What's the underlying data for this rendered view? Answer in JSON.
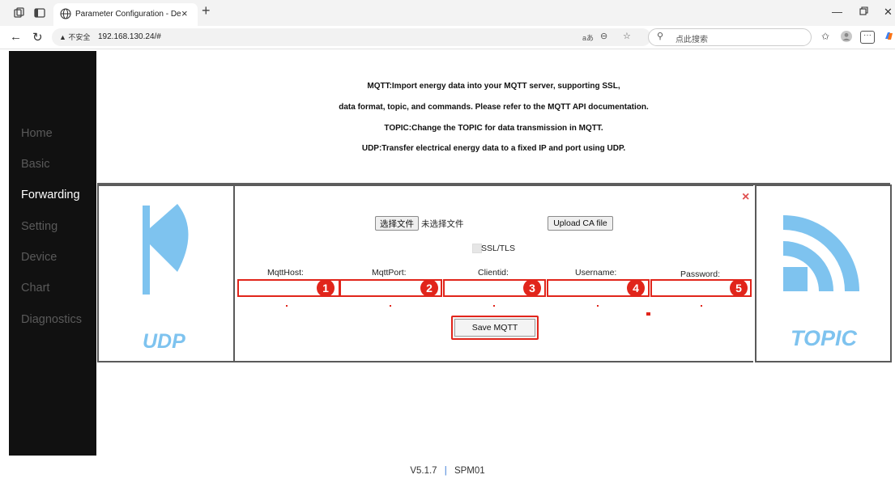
{
  "browser": {
    "tab_title": "Parameter Configuration - Device",
    "tab_close": "×",
    "new_tab": "+",
    "security_label": "不安全",
    "url": "192.168.130.24/#",
    "search_placeholder": "点此搜索",
    "read_aloud": "aあ"
  },
  "sidebar": {
    "items": [
      {
        "label": "Home"
      },
      {
        "label": "Basic"
      },
      {
        "label": "Forwarding"
      },
      {
        "label": "Setting"
      },
      {
        "label": "Device"
      },
      {
        "label": "Chart"
      },
      {
        "label": "Diagnostics"
      }
    ],
    "active": "Forwarding"
  },
  "info": {
    "lines": [
      "MQTT:Import energy data into your MQTT server, supporting SSL,",
      "data format, topic, and commands. Please refer to the MQTT API documentation.",
      "TOPIC:Change the TOPIC for data transmission in MQTT.",
      "UDP:Transfer electrical energy data to a fixed IP and port using UDP."
    ]
  },
  "udp_panel": {
    "label": "UDP"
  },
  "topic_panel": {
    "label": "TOPIC"
  },
  "form": {
    "close": "×",
    "choose_file": "选择文件",
    "no_file": "未选择文件",
    "upload_ca": "Upload CA file",
    "ssl_label": "SSL/TLS",
    "fields": [
      {
        "label": "MqttHost:",
        "value": "",
        "badge": "1"
      },
      {
        "label": "MqttPort:",
        "value": "",
        "badge": "2"
      },
      {
        "label": "Clientid:",
        "value": "",
        "badge": "3"
      },
      {
        "label": "Username:",
        "value": "",
        "badge": "4"
      },
      {
        "label": "Password:",
        "value": "",
        "badge": "5"
      }
    ],
    "save_label": "Save MQTT"
  },
  "footer": {
    "version": "V5.1.7",
    "separator": "|",
    "model": "SPM01"
  },
  "colors": {
    "accent_blue": "#7ec3ef",
    "highlight_red": "#e1251b",
    "sidebar_bg": "#111111"
  }
}
